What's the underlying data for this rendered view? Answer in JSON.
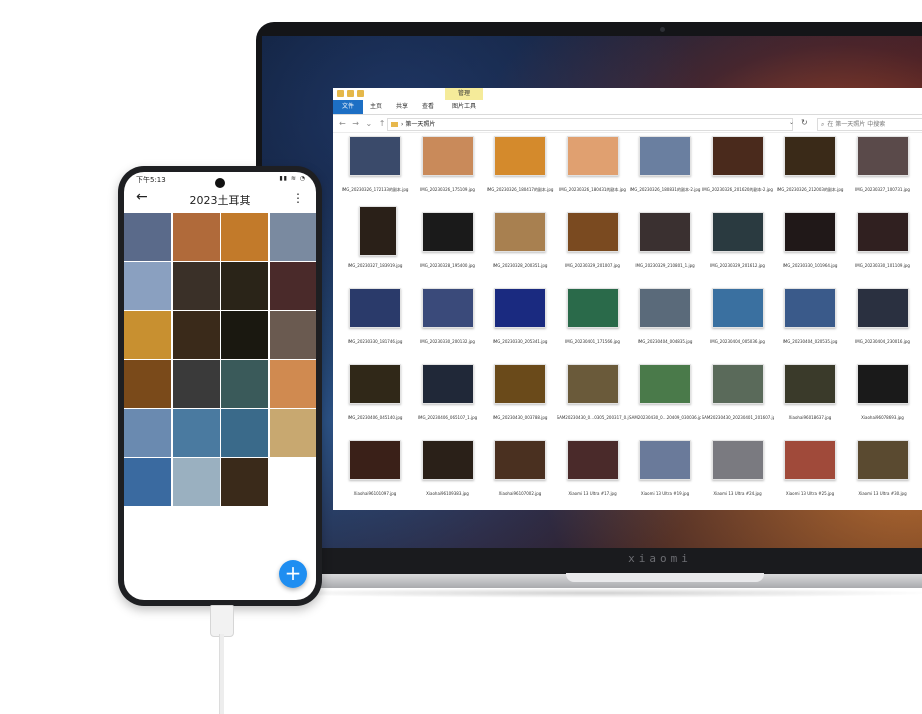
{
  "laptop": {
    "brand": "xiaomi"
  },
  "explorer": {
    "context_tab": "管理",
    "tabs": [
      "文件",
      "主页",
      "共享",
      "查看",
      "图片工具"
    ],
    "nav_arrows": "← → ⌄ ↑",
    "address_sep": "›",
    "address": "第一天照片",
    "search_placeholder": "在 第一天照片 中搜索",
    "files": [
      {
        "name": "IMG_20230326_172133的副本.jpg",
        "color": "#3a4a6a",
        "tall": false
      },
      {
        "name": "IMG_20230326_175109.jpg",
        "color": "#c98a5a",
        "tall": false
      },
      {
        "name": "IMG_20230326_180417的副本.jpg",
        "color": "#d48a2c",
        "tall": false
      },
      {
        "name": "IMG_20230326_180431的副本.jpg",
        "color": "#e0a070",
        "tall": false
      },
      {
        "name": "IMG_20230326_180831的副本-2.jpg",
        "color": "#6a7fa0",
        "tall": false
      },
      {
        "name": "IMG_20230326_201620的副本-2.jpg",
        "color": "#4a2a1c",
        "tall": false
      },
      {
        "name": "IMG_20230326_212003的副本.jpg",
        "color": "#3a2a18",
        "tall": false
      },
      {
        "name": "IMG_20230327_100731.jpg",
        "color": "#5a4a4a",
        "tall": false
      },
      {
        "name": "IMG_20230327_183919.jpg",
        "color": "#2a2018",
        "tall": true
      },
      {
        "name": "IMG_20230328_195400.jpg",
        "color": "#1a1a1a",
        "tall": false
      },
      {
        "name": "IMG_20230328_200351.jpg",
        "color": "#a88050",
        "tall": false
      },
      {
        "name": "IMG_20230329_201007.jpg",
        "color": "#7a4a20",
        "tall": false
      },
      {
        "name": "IMG_20230329_210801_1.jpg",
        "color": "#3a3030",
        "tall": false
      },
      {
        "name": "IMG_20230329_201612.jpg",
        "color": "#2a3a40",
        "tall": false
      },
      {
        "name": "IMG_20230330_101964.jpg",
        "color": "#201818",
        "tall": false
      },
      {
        "name": "IMG_20230330_101109.jpg",
        "color": "#302020",
        "tall": false
      },
      {
        "name": "IMG_20230330_181746.jpg",
        "color": "#2a3a6a",
        "tall": false
      },
      {
        "name": "IMG_20230330_200132.jpg",
        "color": "#3a4a7a",
        "tall": false
      },
      {
        "name": "IMG_20230330_205341.jpg",
        "color": "#1a2a80",
        "tall": false
      },
      {
        "name": "IMG_20230401_171566.jpg",
        "color": "#2a6a4a",
        "tall": false
      },
      {
        "name": "IMG_20230404_004835.jpg",
        "color": "#5a6a7a",
        "tall": false
      },
      {
        "name": "IMG_20230404_005036.jpg",
        "color": "#3a70a0",
        "tall": false
      },
      {
        "name": "IMG_20230404_020535.jpg",
        "color": "#3a5a8a",
        "tall": false
      },
      {
        "name": "IMG_20230404_230016.jpg",
        "color": "#2a3040",
        "tall": false
      },
      {
        "name": "IMG_20230406_045140.jpg",
        "color": "#302818",
        "tall": false
      },
      {
        "name": "IMG_20230406_065107_1.jpg",
        "color": "#202838",
        "tall": false
      },
      {
        "name": "IMG_20230430_003788.jpg",
        "color": "#6a4a1a",
        "tall": false
      },
      {
        "name": "SAM20230430_0…0305_200317_0.jpg",
        "color": "#6a5a3a",
        "tall": false
      },
      {
        "name": "SAM20230430_0…20409_030036.jpg",
        "color": "#4a7a4a",
        "tall": false
      },
      {
        "name": "SAM20230430_20230401_201607.jpg",
        "color": "#5a6a5a",
        "tall": false
      },
      {
        "name": "Xiaohai96018637.jpg",
        "color": "#3a3a2a",
        "tall": false
      },
      {
        "name": "Xiaohai96078693.jpg",
        "color": "#1a1a1a",
        "tall": false
      },
      {
        "name": "Xiaohai96101097.jpg",
        "color": "#3a2018",
        "tall": false
      },
      {
        "name": "Xiaohai96109383.jpg",
        "color": "#2a2018",
        "tall": false
      },
      {
        "name": "Xiaohai96107002.jpg",
        "color": "#4a3020",
        "tall": false
      },
      {
        "name": "Xiaomi 13 Ultra #17.jpg",
        "color": "#4a2a2a",
        "tall": false
      },
      {
        "name": "Xiaomi 13 Ultra #19.jpg",
        "color": "#6a7a9a",
        "tall": false
      },
      {
        "name": "Xiaomi 13 Ultra #24.jpg",
        "color": "#7a7a80",
        "tall": false
      },
      {
        "name": "Xiaomi 13 Ultra #25.jpg",
        "color": "#a04a3a",
        "tall": false
      },
      {
        "name": "Xiaomi 13 Ultra #30.jpg",
        "color": "#5a4a30",
        "tall": false
      }
    ]
  },
  "phone": {
    "time": "下午5:13",
    "status_icons": "▮▮ ≋ ◔",
    "back_icon": "←",
    "title": "2023土耳其",
    "more_icon": "⋮",
    "fab_icon": "+",
    "photos": [
      "#5a6a8a",
      "#b06a3a",
      "#c27a2a",
      "#7a8aa0",
      "#8aa0c0",
      "#3a3028",
      "#2a2418",
      "#4a2a2a",
      "#c89030",
      "#3a2a1a",
      "#1a1810",
      "#6a5a50",
      "#7a4a1a",
      "#3a3a3a",
      "#3a5a5a",
      "#d08a50",
      "#6a8ab0",
      "#4a7aa0",
      "#3a6a8a",
      "#c8a870",
      "#3a6aa0",
      "#9ab0c0",
      "#3a2a1a"
    ]
  }
}
